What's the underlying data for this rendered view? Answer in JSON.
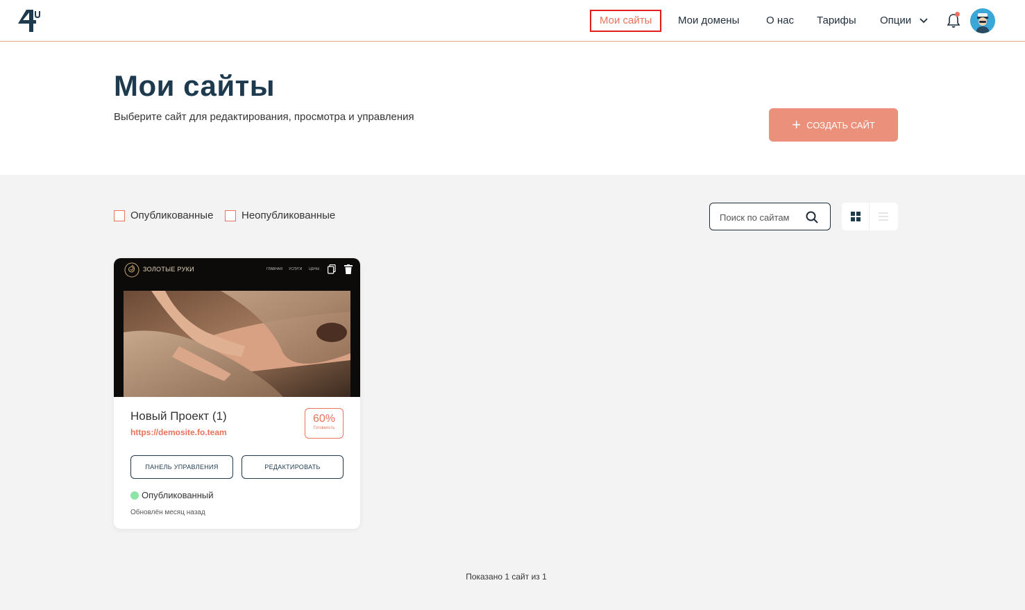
{
  "header": {
    "nav": [
      {
        "label": "Мои сайты",
        "active": true
      },
      {
        "label": "Мои домены"
      },
      {
        "label": "О нас"
      },
      {
        "label": "Тарифы"
      },
      {
        "label": "Опции",
        "dropdown": true
      }
    ],
    "icons": {
      "logo": "4u-logo",
      "notifications": "bell-icon",
      "avatar": "user-avatar"
    },
    "accent_color": "#e8735c",
    "active_nav_border": "#e01e1e"
  },
  "hero": {
    "title": "Мои сайты",
    "subtitle": "Выберите сайт для редактирования, просмотра и управления",
    "create_button": "создать сайт"
  },
  "filters": {
    "published": "Опубликованные",
    "unpublished": "Неопубликованные"
  },
  "search": {
    "placeholder": "Поиск по сайтам"
  },
  "view_mode": {
    "selected": "grid"
  },
  "sites": [
    {
      "preview": {
        "brand": "Золотые руки",
        "nav": [
          "Главная",
          "Услуги",
          "Цены"
        ]
      },
      "title": "Новый Проект (1)",
      "url": "https://demosite.fo.team",
      "readiness": "60%",
      "readiness_label": "Готовность",
      "dashboard_button": "Панель управления",
      "edit_button": "Редактировать",
      "status": "Опубликованный",
      "status_color": "#8ee3a6",
      "updated": "Обновлён месяц назад"
    }
  ],
  "footer": {
    "count_text": "Показано 1 сайт из 1"
  }
}
